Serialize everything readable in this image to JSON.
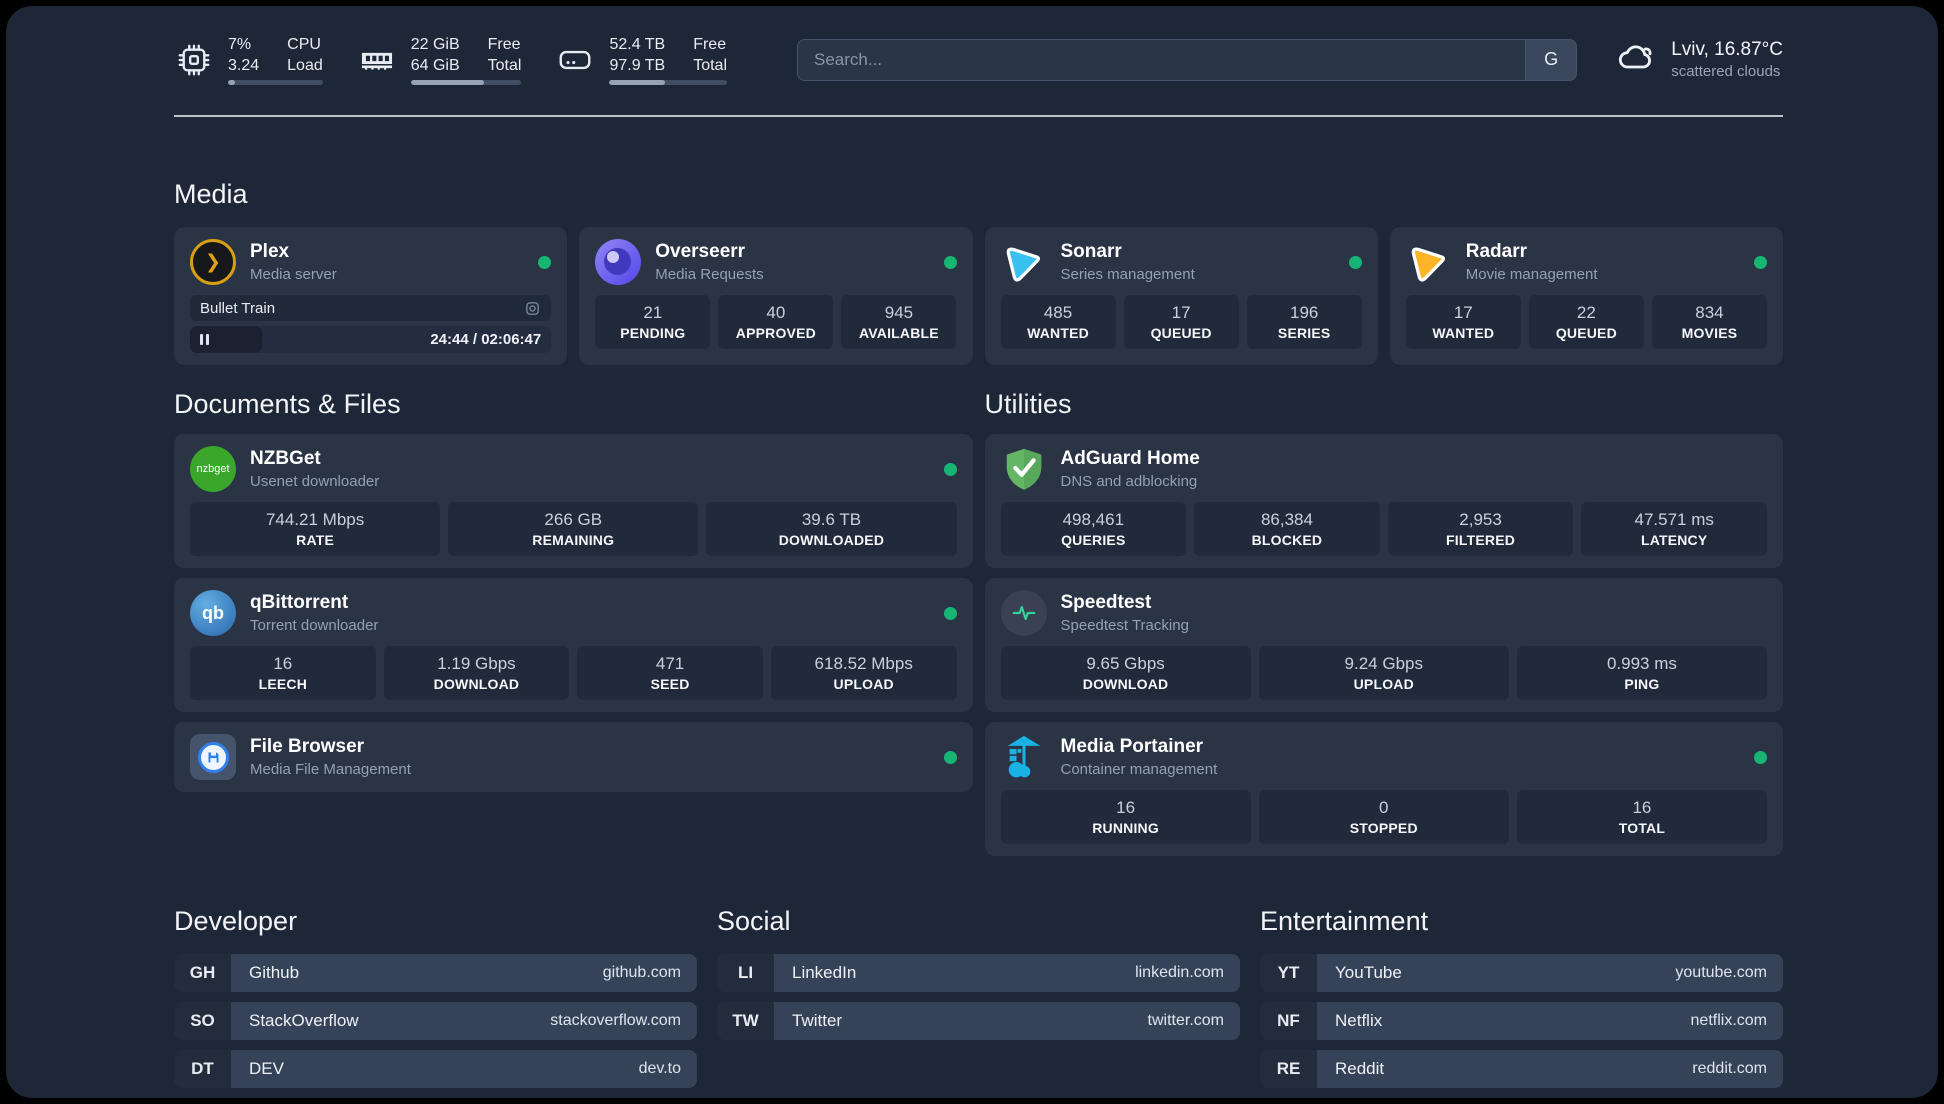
{
  "topbar": {
    "cpu": {
      "value_top": "7%",
      "value_bottom": "3.24",
      "label_top": "CPU",
      "label_bottom": "Load",
      "progress_pct": 7
    },
    "ram": {
      "value_top": "22 GiB",
      "value_bottom": "64 GiB",
      "label_top": "Free",
      "label_bottom": "Total",
      "progress_pct": 66
    },
    "disk": {
      "value_top": "52.4 TB",
      "value_bottom": "97.9 TB",
      "label_top": "Free",
      "label_bottom": "Total",
      "progress_pct": 47
    },
    "search": {
      "placeholder": "Search...",
      "button_label": "G"
    },
    "weather": {
      "location_temp": "Lviv, 16.87°C",
      "condition": "scattered clouds"
    }
  },
  "media": {
    "title": "Media",
    "plex": {
      "name": "Plex",
      "subtitle": "Media server",
      "icon_text": "❯",
      "status": "online",
      "now_playing": {
        "title": "Bullet Train",
        "time_display": "24:44 / 02:06:47",
        "progress_pct": 20
      }
    },
    "overseerr": {
      "name": "Overseerr",
      "subtitle": "Media Requests",
      "status": "online",
      "stats": [
        {
          "value": "21",
          "label": "PENDING"
        },
        {
          "value": "40",
          "label": "APPROVED"
        },
        {
          "value": "945",
          "label": "AVAILABLE"
        }
      ]
    },
    "sonarr": {
      "name": "Sonarr",
      "subtitle": "Series management",
      "status": "online",
      "stats": [
        {
          "value": "485",
          "label": "WANTED"
        },
        {
          "value": "17",
          "label": "QUEUED"
        },
        {
          "value": "196",
          "label": "SERIES"
        }
      ]
    },
    "radarr": {
      "name": "Radarr",
      "subtitle": "Movie management",
      "status": "online",
      "stats": [
        {
          "value": "17",
          "label": "WANTED"
        },
        {
          "value": "22",
          "label": "QUEUED"
        },
        {
          "value": "834",
          "label": "MOVIES"
        }
      ]
    }
  },
  "documents": {
    "title": "Documents & Files",
    "nzbget": {
      "name": "NZBGet",
      "subtitle": "Usenet downloader",
      "icon_text": "nzbget",
      "status": "online",
      "stats": [
        {
          "value": "744.21 Mbps",
          "label": "RATE"
        },
        {
          "value": "266 GB",
          "label": "REMAINING"
        },
        {
          "value": "39.6 TB",
          "label": "DOWNLOADED"
        }
      ]
    },
    "qbittorrent": {
      "name": "qBittorrent",
      "subtitle": "Torrent downloader",
      "icon_text": "qb",
      "status": "online",
      "stats": [
        {
          "value": "16",
          "label": "LEECH"
        },
        {
          "value": "1.19 Gbps",
          "label": "DOWNLOAD"
        },
        {
          "value": "471",
          "label": "SEED"
        },
        {
          "value": "618.52 Mbps",
          "label": "UPLOAD"
        }
      ]
    },
    "filebrowser": {
      "name": "File Browser",
      "subtitle": "Media File Management",
      "status": "online"
    }
  },
  "utilities": {
    "title": "Utilities",
    "adguard": {
      "name": "AdGuard Home",
      "subtitle": "DNS and adblocking",
      "stats": [
        {
          "value": "498,461",
          "label": "QUERIES"
        },
        {
          "value": "86,384",
          "label": "BLOCKED"
        },
        {
          "value": "2,953",
          "label": "FILTERED"
        },
        {
          "value": "47.571 ms",
          "label": "LATENCY"
        }
      ]
    },
    "speedtest": {
      "name": "Speedtest",
      "subtitle": "Speedtest Tracking",
      "stats": [
        {
          "value": "9.65 Gbps",
          "label": "DOWNLOAD"
        },
        {
          "value": "9.24 Gbps",
          "label": "UPLOAD"
        },
        {
          "value": "0.993 ms",
          "label": "PING"
        }
      ]
    },
    "portainer": {
      "name": "Media Portainer",
      "subtitle": "Container management",
      "status": "online",
      "stats": [
        {
          "value": "16",
          "label": "RUNNING"
        },
        {
          "value": "0",
          "label": "STOPPED"
        },
        {
          "value": "16",
          "label": "TOTAL"
        }
      ]
    }
  },
  "links": {
    "developer": {
      "title": "Developer",
      "items": [
        {
          "badge": "GH",
          "name": "Github",
          "url": "github.com"
        },
        {
          "badge": "SO",
          "name": "StackOverflow",
          "url": "stackoverflow.com"
        },
        {
          "badge": "DT",
          "name": "DEV",
          "url": "dev.to"
        }
      ]
    },
    "social": {
      "title": "Social",
      "items": [
        {
          "badge": "LI",
          "name": "LinkedIn",
          "url": "linkedin.com"
        },
        {
          "badge": "TW",
          "name": "Twitter",
          "url": "twitter.com"
        }
      ]
    },
    "entertainment": {
      "title": "Entertainment",
      "items": [
        {
          "badge": "YT",
          "name": "YouTube",
          "url": "youtube.com"
        },
        {
          "badge": "NF",
          "name": "Netflix",
          "url": "netflix.com"
        },
        {
          "badge": "RE",
          "name": "Reddit",
          "url": "reddit.com"
        }
      ]
    }
  },
  "colors": {
    "status_online": "#16b573",
    "plex_accent": "#e5a00d",
    "sonarr_blue": "#38c1f1",
    "radarr_yellow": "#ffb526",
    "adguard_green": "#63b663",
    "portainer_blue": "#18b2e5",
    "speedtest_green": "#34d39d",
    "nzbget_green": "#3aa62b",
    "qbittorrent_blue": "#2a67ad"
  }
}
